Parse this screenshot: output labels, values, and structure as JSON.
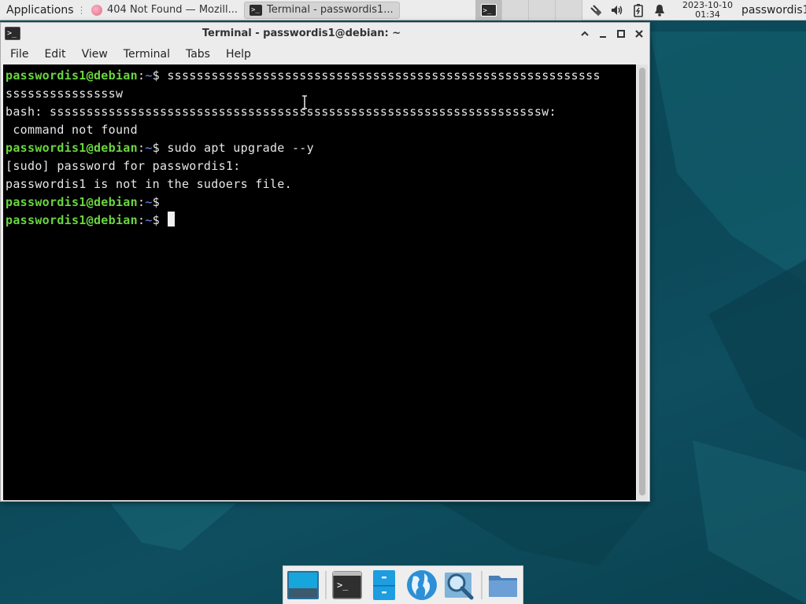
{
  "top_panel": {
    "applications_label": "Applications",
    "tasks": [
      {
        "label": "404 Not Found — Mozill...",
        "icon": "firefox-icon"
      },
      {
        "label": "Terminal - passwordis1...",
        "icon": "terminal-icon"
      }
    ],
    "clock": {
      "date": "2023-10-10",
      "time": "01:34"
    },
    "username": "passwordis1",
    "tray_icons": [
      "network-icon",
      "volume-icon",
      "battery-icon",
      "notifications-icon"
    ]
  },
  "window": {
    "title": "Terminal - passwordis1@debian: ~",
    "menu": [
      "File",
      "Edit",
      "View",
      "Terminal",
      "Tabs",
      "Help"
    ]
  },
  "terminal": {
    "user_host": "passwordis1@debian",
    "path": "~",
    "prompt_symbol": "$",
    "lines": {
      "cmd1_part1": " sssssssssssssssssssssssssssssssssssssssssssssssssssssssssss",
      "cmd1_part2": "sssssssssssssssw",
      "err1_part1": "bash: sssssssssssssssssssssssssssssssssssssssssssssssssssssssssssssssssssw:",
      "err1_part2": " command not found",
      "cmd2": " sudo apt upgrade --y",
      "out1": "[sudo] password for passwordis1:",
      "out2": "passwordis1 is not in the sudoers file."
    }
  },
  "dock": {
    "items": [
      "show-desktop-icon",
      "terminal-icon",
      "file-manager-icon",
      "web-browser-icon",
      "app-finder-icon",
      "folder-icon"
    ]
  },
  "colors": {
    "prompt_user": "#6ad640",
    "prompt_path": "#6f8ef7",
    "terminal_bg": "#000000",
    "desktop_bg": "#0d4a5a"
  }
}
